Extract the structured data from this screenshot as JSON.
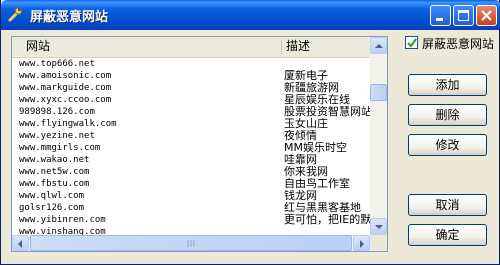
{
  "window": {
    "title": "屏蔽恶意网站",
    "icon": "wrench-icon",
    "colors": {
      "titlebar": "#0a5fe0",
      "close": "#c8401c",
      "face": "#ece9d8"
    }
  },
  "list": {
    "columns": [
      "网站",
      "描述"
    ],
    "rows": [
      {
        "site": "www.top666.net",
        "desc": ""
      },
      {
        "site": "www.amoisonic.com",
        "desc": "厦新电子"
      },
      {
        "site": "www.markguide.com",
        "desc": "新疆旅游网"
      },
      {
        "site": "www.xyxc.ccoo.com",
        "desc": "星辰娱乐在线"
      },
      {
        "site": "989898.126.com",
        "desc": "股票投资智慧网站"
      },
      {
        "site": "www.flyingwalk.com",
        "desc": "玉女山庄"
      },
      {
        "site": "www.yezine.net",
        "desc": "夜倾情"
      },
      {
        "site": "www.mmgirls.com",
        "desc": "MM娱乐时空"
      },
      {
        "site": "www.wakao.net",
        "desc": "哇靠网"
      },
      {
        "site": "www.net5w.com",
        "desc": "你来我网"
      },
      {
        "site": "www.fbstu.com",
        "desc": "自由鸟工作室"
      },
      {
        "site": "www.qlwl.com",
        "desc": "钱龙网"
      },
      {
        "site": "golsr126.com",
        "desc": "红与黑黑客基地"
      },
      {
        "site": "www.yibinren.com",
        "desc": "更可怕，把IE的默认"
      },
      {
        "site": "www.vinshang.com",
        "desc": ""
      }
    ]
  },
  "options": {
    "block_label": "屏蔽恶意网站",
    "block_checked": true
  },
  "buttons": {
    "add": "添加",
    "delete": "删除",
    "modify": "修改",
    "cancel": "取消",
    "ok": "确定"
  }
}
